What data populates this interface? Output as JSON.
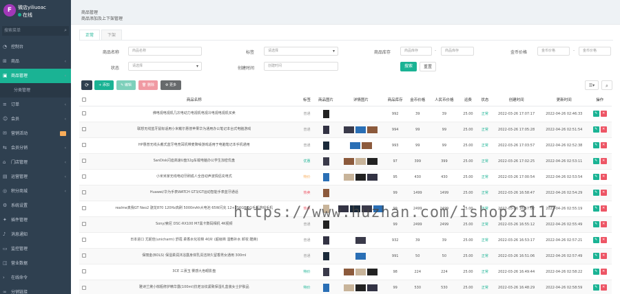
{
  "user": {
    "avatar_text": "F",
    "name": "微店yiliuoac",
    "status": "在线"
  },
  "sidebar": {
    "search_placeholder": "搜索菜单",
    "items": [
      {
        "label": "控制台",
        "icon": "speedometer-icon",
        "state": "normal",
        "arrow": ""
      },
      {
        "label": "商品",
        "icon": "cart-icon",
        "state": "normal",
        "arrow": "‹"
      },
      {
        "label": "商品管理",
        "icon": "bag-icon",
        "state": "active",
        "arrow": "‹"
      },
      {
        "label": "分类管理",
        "icon": "",
        "state": "sub",
        "arrow": ""
      },
      {
        "label": "订单",
        "icon": "list-icon",
        "state": "normal",
        "arrow": "‹"
      },
      {
        "label": "会员",
        "icon": "user-icon",
        "state": "normal",
        "arrow": "‹"
      },
      {
        "label": "营销活动",
        "icon": "gift-icon",
        "state": "normal",
        "arrow": "badge"
      },
      {
        "label": "会员分销",
        "icon": "share-icon",
        "state": "normal",
        "arrow": "‹"
      },
      {
        "label": "门店管理",
        "icon": "store-icon",
        "state": "normal",
        "arrow": "‹"
      },
      {
        "label": "运营管理",
        "icon": "chart-icon",
        "state": "normal",
        "arrow": "‹"
      },
      {
        "label": "积分商城",
        "icon": "coin-icon",
        "state": "normal",
        "arrow": "‹"
      },
      {
        "label": "系统设置",
        "icon": "gear-icon",
        "state": "normal",
        "arrow": ""
      },
      {
        "label": "插件管理",
        "icon": "puzzle-icon",
        "state": "normal",
        "arrow": ""
      },
      {
        "label": "消息通知",
        "icon": "bell-icon",
        "state": "normal",
        "arrow": ""
      },
      {
        "label": "监控管理",
        "icon": "monitor-icon",
        "state": "normal",
        "arrow": ""
      },
      {
        "label": "营业数据",
        "icon": "database-icon",
        "state": "normal",
        "arrow": ""
      },
      {
        "label": "在线命令",
        "icon": "terminal-icon",
        "state": "normal",
        "arrow": ""
      },
      {
        "label": "分销链接",
        "icon": "link-icon",
        "state": "normal",
        "arrow": ""
      }
    ]
  },
  "header": {
    "title": "商品管理",
    "description": "商品添加及上下架管理"
  },
  "tabs": [
    {
      "label": "正常"
    },
    {
      "label": "下架"
    }
  ],
  "filters": {
    "name_label": "商品名称",
    "name_placeholder": "商品名称",
    "tag_label": "标签",
    "tag_value": "请选择",
    "stock_label": "商品库存",
    "stock_min_placeholder": "商品库存",
    "stock_max_placeholder": "商品库存",
    "coin_label": "金币价格",
    "coin_min_placeholder": "金币价格",
    "coin_max_placeholder": "金币价格",
    "status_label": "状态",
    "status_value": "请选择",
    "time_label": "创建时间",
    "time_placeholder": "创建时间",
    "search_button": "搜索",
    "reset_button": "重置"
  },
  "toolbar": {
    "refresh": "⟳",
    "add": "+ 添加",
    "edit": "✎ 编辑",
    "delete": "🗑 删除",
    "more": "⚙ 更多"
  },
  "table": {
    "columns": [
      "",
      "商品名称",
      "标签",
      "商品图片",
      "详情图片",
      "商品库存",
      "金币价格",
      "人民币价格",
      "运费",
      "状态",
      "创建时间",
      "更新时间",
      "操作"
    ],
    "rows": [
      {
        "name": "佛电视电视机几次电动力电视机电视冷电视电视机买卖",
        "tag": "普通",
        "tag_color": "#999999",
        "stock": "992",
        "coin": "39",
        "rmb": "39",
        "ship": "25.00",
        "status": "正常",
        "created": "2022-03-26 17:07:17",
        "updated": "2022-04-26 02:46:33",
        "thumbs": 1,
        "details": 0
      },
      {
        "name": "联想无线蓝牙鼠标适用小米戴尔惠普苹果华为通用办公笔记本台式电脑游戏",
        "tag": "普通",
        "tag_color": "#999999",
        "stock": "994",
        "coin": "99",
        "rmb": "99",
        "ship": "25.00",
        "status": "正常",
        "created": "2022-03-26 17:05:28",
        "updated": "2022-04-26 02:51:54",
        "thumbs": 1,
        "details": 3
      },
      {
        "name": "HP惠普无线头戴式蓝牙电竞耳机带麦降噪游戏适用于电脑笔记本手机通用",
        "tag": "普通",
        "tag_color": "#999999",
        "stock": "993",
        "coin": "99",
        "rmb": "99",
        "ship": "25.00",
        "status": "正常",
        "created": "2022-03-26 17:03:57",
        "updated": "2022-04-26 02:52:38",
        "thumbs": 1,
        "details": 2
      },
      {
        "name": "SanDisk闪迪高速U盘32g车载电脑办公学生加密优盘",
        "tag": "优惠",
        "tag_color": "#1ab394",
        "stock": "97",
        "coin": "399",
        "rmb": "399",
        "ship": "25.00",
        "status": "正常",
        "created": "2022-03-26 17:02:25",
        "updated": "2022-04-26 02:53:11",
        "thumbs": 1,
        "details": 3
      },
      {
        "name": "小米米家无线电动牙刷成人全自动声波情侣充电式",
        "tag": "特价",
        "tag_color": "#f8ac59",
        "stock": "95",
        "coin": "430",
        "rmb": "430",
        "ship": "25.00",
        "status": "正常",
        "created": "2022-03-26 17:00:54",
        "updated": "2022-04-26 02:53:54",
        "thumbs": 1,
        "details": 3
      },
      {
        "name": "Huawei/华为手表WATCH GT3/GT运动智能手表蓝牙通话",
        "tag": "热卖",
        "tag_color": "#ed5565",
        "stock": "99",
        "coin": "1499",
        "rmb": "1499",
        "ship": "25.00",
        "status": "正常",
        "created": "2022-03-26 16:58:47",
        "updated": "2022-04-26 02:54:29",
        "thumbs": 1,
        "details": 0
      },
      {
        "name": "realme真我GT Neo2 骁龙870 120Hz高刷 5000mAh大电池 65W闪充 12+256GB 5G手机游戏手机",
        "tag": "热卖",
        "tag_color": "#ed5565",
        "stock": "99",
        "coin": "2499",
        "rmb": "2499",
        "ship": "25.00",
        "status": "正常",
        "created": "2022-03-26 16:57:02",
        "updated": "2022-04-26 02:55:19",
        "thumbs": 1,
        "details": 4
      },
      {
        "name": "Sony/索尼 DSC-RX100 M7黑卡数码相机 4K视频",
        "tag": "普通",
        "tag_color": "#999999",
        "stock": "99",
        "coin": "2499",
        "rmb": "2499",
        "ship": "25.00",
        "status": "正常",
        "created": "2022-03-26 16:55:12",
        "updated": "2022-04-26 02:55:49",
        "thumbs": 1,
        "details": 0
      },
      {
        "name": "日本进口 尤妮佳(unicharm) 舒蔻 柔香水化妆棉 40片 (超级棉 湿敷补水 卸妆 酷爽)",
        "tag": "普通",
        "tag_color": "#999999",
        "stock": "932",
        "coin": "39",
        "rmb": "39",
        "ship": "25.00",
        "status": "正常",
        "created": "2022-03-26 16:53:17",
        "updated": "2022-04-26 02:57:21",
        "thumbs": 1,
        "details": 1
      },
      {
        "name": "保丽金(BOLS) 保湿柔润沐浴露身体乳清洁持久留香男女通用 300ml",
        "tag": "普通",
        "tag_color": "#999999",
        "stock": "991",
        "coin": "50",
        "rmb": "50",
        "ship": "25.00",
        "status": "正常",
        "created": "2022-03-26 16:51:06",
        "updated": "2022-04-26 02:57:49",
        "thumbs": 1,
        "details": 1
      },
      {
        "name": "3CE 三熹玉 雾感九色眼影盘",
        "tag": "特价",
        "tag_color": "#1ab394",
        "stock": "98",
        "coin": "224",
        "rmb": "224",
        "ship": "25.00",
        "status": "正常",
        "created": "2022-03-26 16:49:44",
        "updated": "2022-04-26 02:58:22",
        "thumbs": 1,
        "details": 3
      },
      {
        "name": "雅诗兰黛小棕瓶修护精华露(100ml)抗老淡纹紧致保湿礼盒装女士护肤品",
        "tag": "特价",
        "tag_color": "#1ab394",
        "stock": "99",
        "coin": "530",
        "rmb": "530",
        "ship": "25.00",
        "status": "正常",
        "created": "2022-03-26 16:48:29",
        "updated": "2022-04-26 02:58:59",
        "thumbs": 1,
        "details": 3
      }
    ]
  },
  "watermark": "https://www.huzhan.com/ishop23117",
  "colors": {
    "primary": "#1ab394",
    "sidebar": "#2f4050",
    "danger": "#ed5565",
    "dark": "#2f4050",
    "gray": "#8a95a3"
  }
}
